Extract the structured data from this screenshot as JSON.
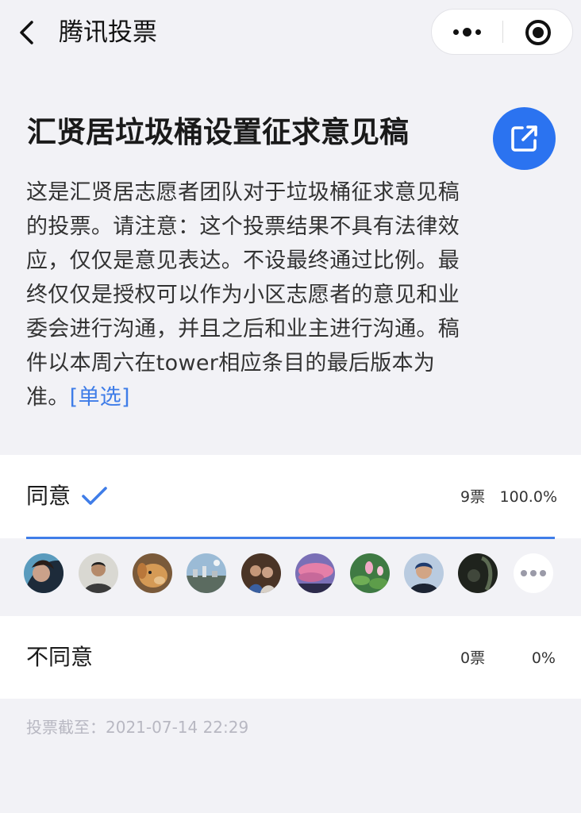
{
  "navbar": {
    "title": "腾讯投票",
    "back_icon": "chevron-left-icon",
    "more_icon": "more-dots-icon",
    "close_icon": "miniprogram-close-icon"
  },
  "poll": {
    "title": "汇贤居垃圾桶设置征求意见稿",
    "description": "这是汇贤居志愿者团队对于垃圾桶征求意见稿的投票。请注意：这个投票结果不具有法律效应，仅仅是意见表达。不设最终通过比例。最终仅仅是授权可以作为小区志愿者的意见和业委会进行沟通，并且之后和业主进行沟通。稿件以本周六在tower相应条目的最后版本为准。",
    "type_label": "[单选]",
    "share_icon": "share-external-icon",
    "deadline": "投票截至：2021-07-14 22:29"
  },
  "options": [
    {
      "label": "同意",
      "votes": "9票",
      "percent": "100.0%",
      "fraction": 1.0,
      "selected": true
    },
    {
      "label": "不同意",
      "votes": "0票",
      "percent": "0%",
      "fraction": 0.0,
      "selected": false
    }
  ],
  "voters": {
    "shown_count": 9,
    "more_icon": "more-horizontal-icon"
  },
  "colors": {
    "accent": "#3f7de8",
    "share_button": "#2b73f0",
    "background": "#f2f2f6"
  }
}
